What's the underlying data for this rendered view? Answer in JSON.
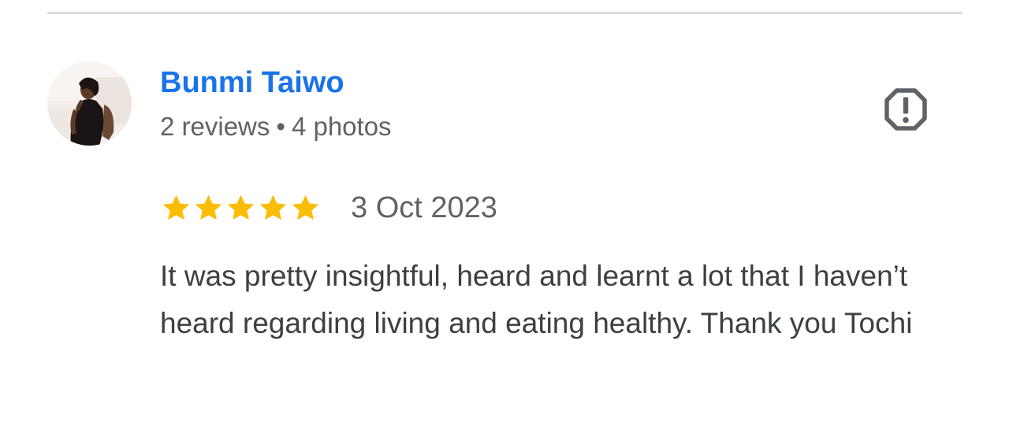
{
  "reviewer": {
    "name": "Bunmi Taiwo",
    "review_count": "2 reviews",
    "separator": "•",
    "photo_count": "4 photos"
  },
  "review": {
    "rating": 5,
    "rating_max": 5,
    "date": "3 Oct 2023",
    "text": "It was pretty insightful, heard and learnt a lot that I haven’t heard regarding living and eating healthy. Thank you Tochi"
  },
  "icons": {
    "avatar": "profile-photo",
    "report": "report-flag-icon",
    "star": "star-icon"
  },
  "colors": {
    "name": "#1a73e8",
    "star": "#fbbc04",
    "meta": "#5f6368",
    "text": "#3c4043",
    "divider": "#dadce0",
    "report_icon": "#5f6368"
  }
}
